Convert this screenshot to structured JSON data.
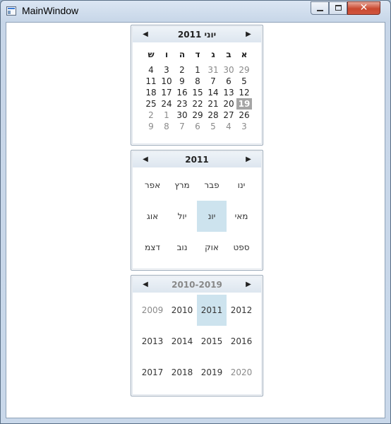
{
  "window": {
    "title": "MainWindow",
    "close_glyph": "✕"
  },
  "month_view": {
    "title": "יוני 2011",
    "prev_icon": "◀",
    "next_icon": "▶",
    "day_headers": [
      "ש",
      "ו",
      "ה",
      "ד",
      "ג",
      "ב",
      "א"
    ],
    "weeks": [
      [
        "4",
        "3",
        "2",
        "1",
        "31",
        "30",
        "29"
      ],
      [
        "11",
        "10",
        "9",
        "8",
        "7",
        "6",
        "5"
      ],
      [
        "18",
        "17",
        "16",
        "15",
        "14",
        "13",
        "12"
      ],
      [
        "25",
        "24",
        "23",
        "22",
        "21",
        "20",
        "19"
      ],
      [
        "2",
        "1",
        "30",
        "29",
        "28",
        "27",
        "26"
      ],
      [
        "9",
        "8",
        "7",
        "6",
        "5",
        "4",
        "3"
      ]
    ],
    "today": "19"
  },
  "year_view": {
    "title": "2011",
    "prev_icon": "◀",
    "next_icon": "▶",
    "rows": [
      [
        "אפר",
        "מרץ",
        "פבר",
        "ינו"
      ],
      [
        "אוג",
        "יול",
        "יונ",
        "מאי"
      ],
      [
        "דצמ",
        "נוב",
        "אוק",
        "ספט"
      ]
    ],
    "selected": "יונ"
  },
  "decade_view": {
    "title": "2010-2019",
    "prev_icon": "◀",
    "next_icon": "▶",
    "rows": [
      [
        "2009",
        "2010",
        "2011",
        "2012"
      ],
      [
        "2013",
        "2014",
        "2015",
        "2016"
      ],
      [
        "2017",
        "2018",
        "2019",
        "2020"
      ]
    ],
    "selected": "2011"
  }
}
